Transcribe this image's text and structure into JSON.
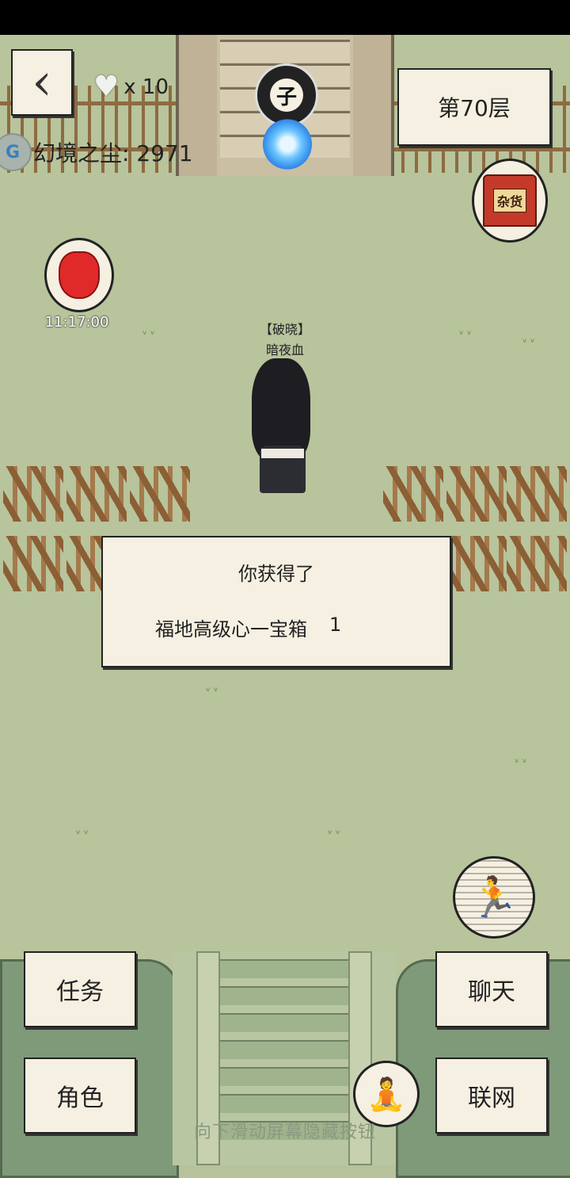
{
  "header": {
    "back_icon": "back-arrow-icon",
    "hearts_icon": "heart-icon",
    "hearts_count": "x 10",
    "dust_label": "幻境之尘: 2971",
    "floor_label": "第70层",
    "zi_badge": "子"
  },
  "side_icons": {
    "shop_label": "杂货",
    "bag_timer": "11:17:00"
  },
  "player": {
    "title": "【破晓】",
    "name": "暗夜血"
  },
  "dialog": {
    "title": "你获得了",
    "item_name": "福地高级心一宝箱",
    "item_count": "1"
  },
  "menu": {
    "task": "任务",
    "role": "角色",
    "chat": "聊天",
    "network": "联网"
  },
  "action_icons": {
    "run": "running-figure-icon",
    "meditate": "meditating-figure-icon"
  },
  "hint": "向下滑动屏幕隐藏按钮",
  "colors": {
    "ground": "#b8c49c",
    "paper": "#f5f0e1",
    "ink": "#222222"
  }
}
